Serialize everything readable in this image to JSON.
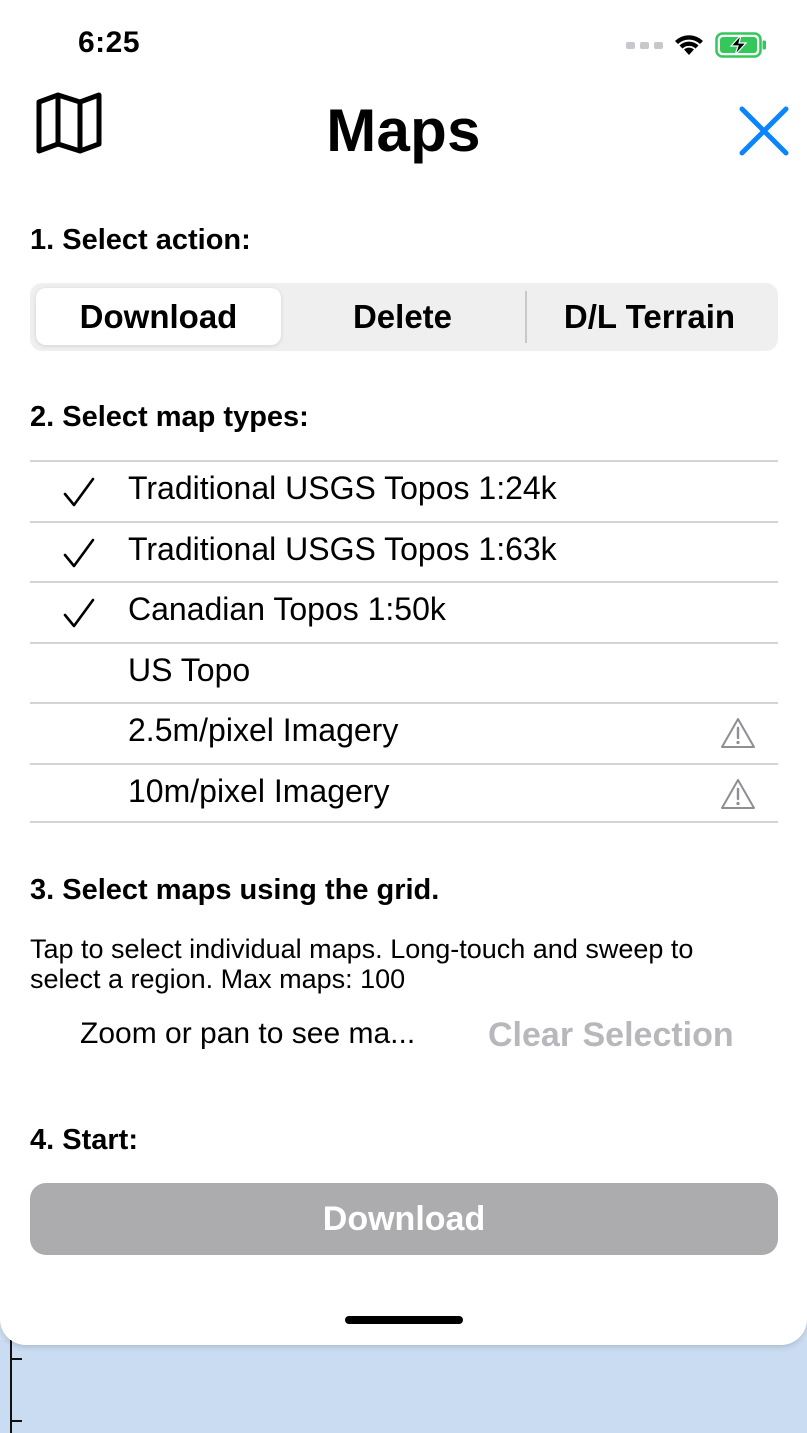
{
  "status_bar": {
    "time": "6:25",
    "icons": [
      "signal-dots",
      "wifi-icon",
      "battery-charging-icon"
    ],
    "battery_color": "#34c759"
  },
  "header": {
    "title": "Maps",
    "left_icon": "map-icon",
    "close_icon": "close-icon",
    "accent_color": "#0a84ff"
  },
  "step1": {
    "label": "1. Select action:",
    "segments": [
      {
        "label": "Download",
        "selected": true
      },
      {
        "label": "Delete",
        "selected": false
      },
      {
        "label": "D/L Terrain",
        "selected": false
      }
    ]
  },
  "step2": {
    "label": "2. Select map types:",
    "map_types": [
      {
        "label": "Traditional USGS Topos 1:24k",
        "checked": true,
        "warning": false
      },
      {
        "label": "Traditional USGS Topos 1:63k",
        "checked": true,
        "warning": false
      },
      {
        "label": "Canadian Topos 1:50k",
        "checked": true,
        "warning": false
      },
      {
        "label": "US Topo",
        "checked": false,
        "warning": false
      },
      {
        "label": "2.5m/pixel Imagery",
        "checked": false,
        "warning": true
      },
      {
        "label": "10m/pixel Imagery",
        "checked": false,
        "warning": true
      }
    ]
  },
  "step3": {
    "label": "3. Select maps using the grid.",
    "help": "Tap to select individual maps. Long-touch and sweep to select a region. Max maps: 100",
    "zoom_status": "Zoom or pan to see ma...",
    "clear_label": "Clear Selection"
  },
  "step4": {
    "label": "4. Start:",
    "button_label": "Download"
  }
}
